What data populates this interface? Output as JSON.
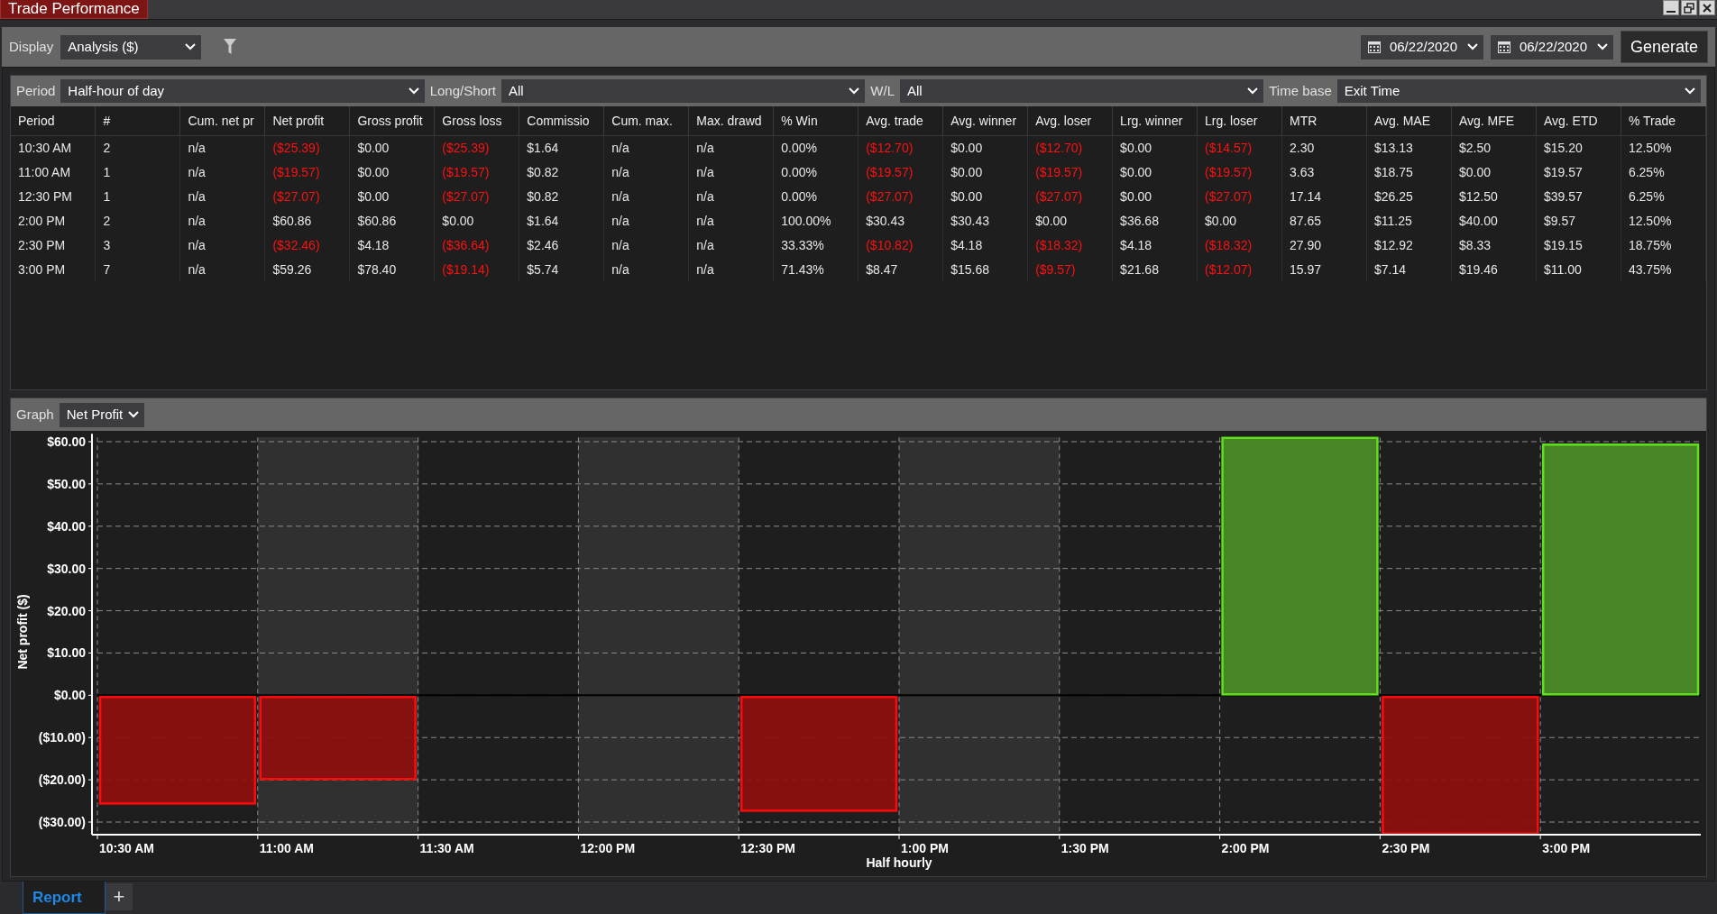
{
  "window": {
    "title": "Trade Performance"
  },
  "toolbar": {
    "display_label": "Display",
    "display_value": "Analysis ($)",
    "start_date": "06/22/2020",
    "end_date": "06/22/2020",
    "generate_button": "Generate"
  },
  "filters": [
    {
      "label": "Period",
      "value": "Half-hour of day"
    },
    {
      "label": "Long/Short",
      "value": "All"
    },
    {
      "label": "W/L",
      "value": "All"
    },
    {
      "label": "Time base",
      "value": "Exit Time"
    }
  ],
  "table": {
    "columns": [
      "Period",
      "#",
      "Cum. net pr",
      "Net profit",
      "Gross profit",
      "Gross loss",
      "Commissio",
      "Cum. max.",
      "Max. drawd",
      "% Win",
      "Avg. trade",
      "Avg. winner",
      "Avg. loser",
      "Lrg. winner",
      "Lrg. loser",
      "MTR",
      "Avg. MAE",
      "Avg. MFE",
      "Avg. ETD",
      "% Trade"
    ],
    "rows": [
      {
        "cells": [
          {
            "text": "10:30 AM",
            "negative": false
          },
          {
            "text": "2",
            "negative": false
          },
          {
            "text": "n/a",
            "negative": false
          },
          {
            "text": "($25.39)",
            "negative": true
          },
          {
            "text": "$0.00",
            "negative": false
          },
          {
            "text": "($25.39)",
            "negative": true
          },
          {
            "text": "$1.64",
            "negative": false
          },
          {
            "text": "n/a",
            "negative": false
          },
          {
            "text": "n/a",
            "negative": false
          },
          {
            "text": "0.00%",
            "negative": false
          },
          {
            "text": "($12.70)",
            "negative": true
          },
          {
            "text": "$0.00",
            "negative": false
          },
          {
            "text": "($12.70)",
            "negative": true
          },
          {
            "text": "$0.00",
            "negative": false
          },
          {
            "text": "($14.57)",
            "negative": true
          },
          {
            "text": "2.30",
            "negative": false
          },
          {
            "text": "$13.13",
            "negative": false
          },
          {
            "text": "$2.50",
            "negative": false
          },
          {
            "text": "$15.20",
            "negative": false
          },
          {
            "text": "12.50%",
            "negative": false
          }
        ]
      },
      {
        "cells": [
          {
            "text": "11:00 AM",
            "negative": false
          },
          {
            "text": "1",
            "negative": false
          },
          {
            "text": "n/a",
            "negative": false
          },
          {
            "text": "($19.57)",
            "negative": true
          },
          {
            "text": "$0.00",
            "negative": false
          },
          {
            "text": "($19.57)",
            "negative": true
          },
          {
            "text": "$0.82",
            "negative": false
          },
          {
            "text": "n/a",
            "negative": false
          },
          {
            "text": "n/a",
            "negative": false
          },
          {
            "text": "0.00%",
            "negative": false
          },
          {
            "text": "($19.57)",
            "negative": true
          },
          {
            "text": "$0.00",
            "negative": false
          },
          {
            "text": "($19.57)",
            "negative": true
          },
          {
            "text": "$0.00",
            "negative": false
          },
          {
            "text": "($19.57)",
            "negative": true
          },
          {
            "text": "3.63",
            "negative": false
          },
          {
            "text": "$18.75",
            "negative": false
          },
          {
            "text": "$0.00",
            "negative": false
          },
          {
            "text": "$19.57",
            "negative": false
          },
          {
            "text": "6.25%",
            "negative": false
          }
        ]
      },
      {
        "cells": [
          {
            "text": "12:30 PM",
            "negative": false
          },
          {
            "text": "1",
            "negative": false
          },
          {
            "text": "n/a",
            "negative": false
          },
          {
            "text": "($27.07)",
            "negative": true
          },
          {
            "text": "$0.00",
            "negative": false
          },
          {
            "text": "($27.07)",
            "negative": true
          },
          {
            "text": "$0.82",
            "negative": false
          },
          {
            "text": "n/a",
            "negative": false
          },
          {
            "text": "n/a",
            "negative": false
          },
          {
            "text": "0.00%",
            "negative": false
          },
          {
            "text": "($27.07)",
            "negative": true
          },
          {
            "text": "$0.00",
            "negative": false
          },
          {
            "text": "($27.07)",
            "negative": true
          },
          {
            "text": "$0.00",
            "negative": false
          },
          {
            "text": "($27.07)",
            "negative": true
          },
          {
            "text": "17.14",
            "negative": false
          },
          {
            "text": "$26.25",
            "negative": false
          },
          {
            "text": "$12.50",
            "negative": false
          },
          {
            "text": "$39.57",
            "negative": false
          },
          {
            "text": "6.25%",
            "negative": false
          }
        ]
      },
      {
        "cells": [
          {
            "text": "2:00 PM",
            "negative": false
          },
          {
            "text": "2",
            "negative": false
          },
          {
            "text": "n/a",
            "negative": false
          },
          {
            "text": "$60.86",
            "negative": false
          },
          {
            "text": "$60.86",
            "negative": false
          },
          {
            "text": "$0.00",
            "negative": false
          },
          {
            "text": "$1.64",
            "negative": false
          },
          {
            "text": "n/a",
            "negative": false
          },
          {
            "text": "n/a",
            "negative": false
          },
          {
            "text": "100.00%",
            "negative": false
          },
          {
            "text": "$30.43",
            "negative": false
          },
          {
            "text": "$30.43",
            "negative": false
          },
          {
            "text": "$0.00",
            "negative": false
          },
          {
            "text": "$36.68",
            "negative": false
          },
          {
            "text": "$0.00",
            "negative": false
          },
          {
            "text": "87.65",
            "negative": false
          },
          {
            "text": "$11.25",
            "negative": false
          },
          {
            "text": "$40.00",
            "negative": false
          },
          {
            "text": "$9.57",
            "negative": false
          },
          {
            "text": "12.50%",
            "negative": false
          }
        ]
      },
      {
        "cells": [
          {
            "text": "2:30 PM",
            "negative": false
          },
          {
            "text": "3",
            "negative": false
          },
          {
            "text": "n/a",
            "negative": false
          },
          {
            "text": "($32.46)",
            "negative": true
          },
          {
            "text": "$4.18",
            "negative": false
          },
          {
            "text": "($36.64)",
            "negative": true
          },
          {
            "text": "$2.46",
            "negative": false
          },
          {
            "text": "n/a",
            "negative": false
          },
          {
            "text": "n/a",
            "negative": false
          },
          {
            "text": "33.33%",
            "negative": false
          },
          {
            "text": "($10.82)",
            "negative": true
          },
          {
            "text": "$4.18",
            "negative": false
          },
          {
            "text": "($18.32)",
            "negative": true
          },
          {
            "text": "$4.18",
            "negative": false
          },
          {
            "text": "($18.32)",
            "negative": true
          },
          {
            "text": "27.90",
            "negative": false
          },
          {
            "text": "$12.92",
            "negative": false
          },
          {
            "text": "$8.33",
            "negative": false
          },
          {
            "text": "$19.15",
            "negative": false
          },
          {
            "text": "18.75%",
            "negative": false
          }
        ]
      },
      {
        "cells": [
          {
            "text": "3:00 PM",
            "negative": false
          },
          {
            "text": "7",
            "negative": false
          },
          {
            "text": "n/a",
            "negative": false
          },
          {
            "text": "$59.26",
            "negative": false
          },
          {
            "text": "$78.40",
            "negative": false
          },
          {
            "text": "($19.14)",
            "negative": true
          },
          {
            "text": "$5.74",
            "negative": false
          },
          {
            "text": "n/a",
            "negative": false
          },
          {
            "text": "n/a",
            "negative": false
          },
          {
            "text": "71.43%",
            "negative": false
          },
          {
            "text": "$8.47",
            "negative": false
          },
          {
            "text": "$15.68",
            "negative": false
          },
          {
            "text": "($9.57)",
            "negative": true
          },
          {
            "text": "$21.68",
            "negative": false
          },
          {
            "text": "($12.07)",
            "negative": true
          },
          {
            "text": "15.97",
            "negative": false
          },
          {
            "text": "$7.14",
            "negative": false
          },
          {
            "text": "$19.46",
            "negative": false
          },
          {
            "text": "$11.00",
            "negative": false
          },
          {
            "text": "43.75%",
            "negative": false
          }
        ]
      }
    ]
  },
  "graph": {
    "label": "Graph",
    "value": "Net Profit",
    "chart_data": {
      "type": "bar",
      "xlabel": "Half hourly",
      "ylabel": "Net profit ($)",
      "categories": [
        "10:30 AM",
        "11:00 AM",
        "11:30 AM",
        "12:00 PM",
        "12:30 PM",
        "1:00 PM",
        "1:30 PM",
        "2:00 PM",
        "2:30 PM",
        "3:00 PM"
      ],
      "series": [
        {
          "values": [
            -25.4,
            -19.6,
            null,
            null,
            -27.1,
            null,
            null,
            60.9,
            -32.5,
            59.3
          ]
        }
      ],
      "grid": true,
      "ylim": [
        -33,
        61
      ],
      "yticks": [
        {
          "value": 60,
          "label": "$60.00"
        },
        {
          "value": 50,
          "label": "$50.00"
        },
        {
          "value": 40,
          "label": "$40.00"
        },
        {
          "value": 30,
          "label": "$30.00"
        },
        {
          "value": 20,
          "label": "$20.00"
        },
        {
          "value": 10,
          "label": "$10.00"
        },
        {
          "value": 0,
          "label": "$0.00"
        },
        {
          "value": -10,
          "label": "($10.00)"
        },
        {
          "value": -20,
          "label": "($20.00)"
        },
        {
          "value": -30,
          "label": "($30.00)"
        }
      ]
    }
  },
  "bottom_tabs": [
    {
      "label": "Report",
      "selected": true
    }
  ],
  "add_tab_button": "+"
}
